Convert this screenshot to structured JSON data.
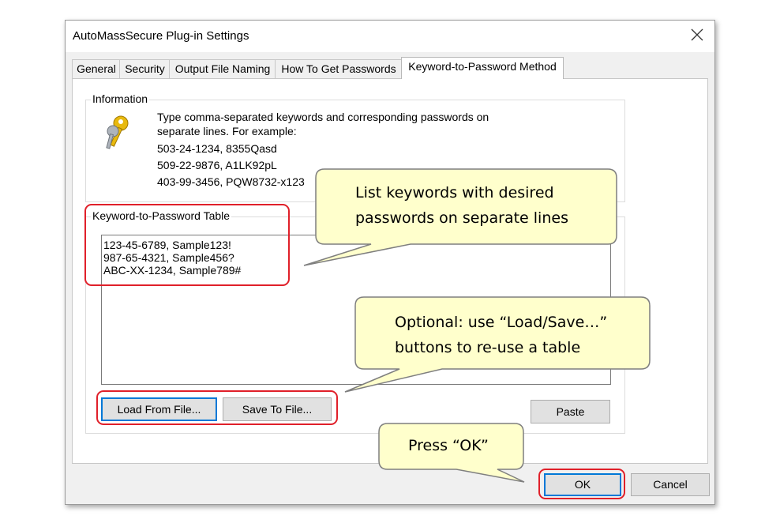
{
  "dialog": {
    "title": "AutoMassSecure Plug-in Settings",
    "tabs": [
      "General",
      "Security",
      "Output File Naming",
      "How To Get Passwords",
      "Keyword-to-Password Method"
    ],
    "active_tab": "Keyword-to-Password Method"
  },
  "information": {
    "label": "Information",
    "description_line1": "Type comma-separated keywords and corresponding passwords on",
    "description_line2": "separate lines. For example:",
    "examples": [
      "503-24-1234, 8355Qasd",
      "509-22-9876, A1LK92pL",
      "403-99-3456, PQW8732-x123"
    ]
  },
  "table": {
    "label": "Keyword-to-Password Table",
    "lines": [
      "123-45-6789, Sample123!",
      "987-65-4321, Sample456?",
      "ABC-XX-1234, Sample789#"
    ]
  },
  "buttons": {
    "load": "Load From File...",
    "save": "Save To File...",
    "paste": "Paste",
    "ok": "OK",
    "cancel": "Cancel"
  },
  "callouts": {
    "list_line1": "List keywords with desired",
    "list_line2": "passwords on separate lines",
    "optional_line1": "Optional: use “Load/Save…”",
    "optional_line2": "buttons to re-use a table",
    "press_ok": "Press “OK”"
  },
  "colors": {
    "highlight_red": "#e0202a",
    "callout_fill": "#ffffcc",
    "callout_stroke": "#7f7f7f",
    "focus_blue": "#0078d7"
  },
  "icons": [
    "keys-icon",
    "close-icon"
  ]
}
